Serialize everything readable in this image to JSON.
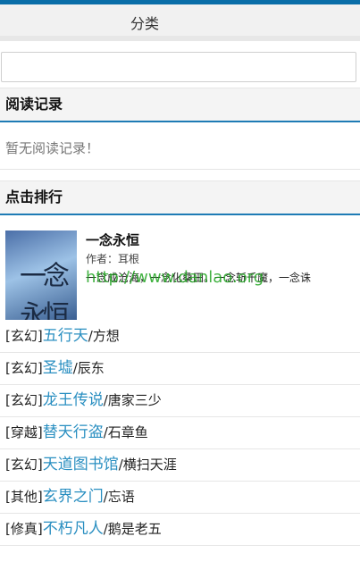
{
  "header": {
    "category_label": "分类"
  },
  "search": {
    "value": "",
    "placeholder": ""
  },
  "reading_history": {
    "heading": "阅读记录",
    "empty_text": "暂无阅读记录！"
  },
  "ranking": {
    "heading": "点击排行",
    "featured": {
      "title": "一念永恒",
      "author": "作者：耳根",
      "description": "一念成沧海，一念化桑田。一念斩千魔，一念诛",
      "cover_title": "一念永恒",
      "watermark": "http://www.danlao.org"
    },
    "items": [
      {
        "category": "[玄幻]",
        "title": "五行天",
        "author": "/方想"
      },
      {
        "category": "[玄幻]",
        "title": "圣墟",
        "author": "/辰东"
      },
      {
        "category": "[玄幻]",
        "title": "龙王传说",
        "author": "/唐家三少"
      },
      {
        "category": "[穿越]",
        "title": "替天行盗",
        "author": "/石章鱼"
      },
      {
        "category": "[玄幻]",
        "title": "天道图书馆",
        "author": "/横扫天涯"
      },
      {
        "category": "[其他]",
        "title": "玄界之门",
        "author": "/忘语"
      },
      {
        "category": "[修真]",
        "title": "不朽凡人",
        "author": "/鹅是老五"
      }
    ]
  }
}
